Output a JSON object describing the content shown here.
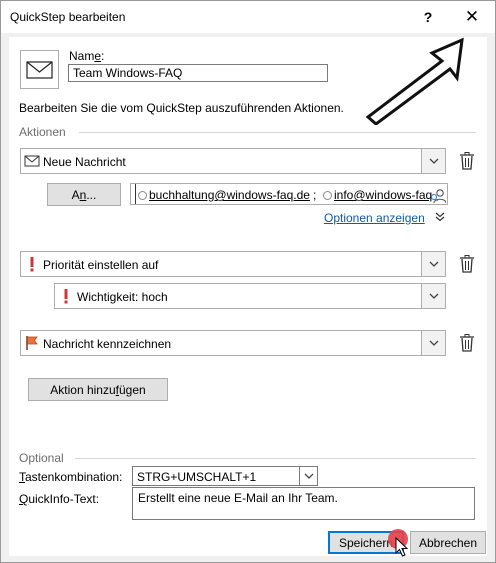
{
  "window": {
    "title": "QuickStep bearbeiten",
    "help_glyph": "?",
    "close_glyph": "✕"
  },
  "name": {
    "label_prefix": "Nam",
    "label_mnemonic": "e",
    "label_suffix": ":",
    "value": "Team Windows-FAQ"
  },
  "instruction": "Bearbeiten Sie die vom QuickStep auszuführenden Aktionen.",
  "actions": {
    "group_label": "Aktionen",
    "items": [
      {
        "label": "Neue Nachricht",
        "icon": "envelope-icon"
      },
      {
        "label": "Priorität einstellen auf",
        "icon": "exclamation-icon",
        "sub_option": "Wichtigkeit: hoch"
      },
      {
        "label": "Nachricht kennzeichnen",
        "icon": "flag-icon"
      }
    ],
    "to_button": {
      "prefix": "A",
      "mnemonic": "n",
      "suffix": "..."
    },
    "recipients": [
      "buchhaltung@windows-faq.de",
      "info@windows-faq"
    ],
    "recipient_separator": ";",
    "show_options_link": "Optionen anzeigen",
    "add_action_button": {
      "prefix": "Aktion hinzu",
      "mnemonic": "f",
      "suffix": "ügen"
    }
  },
  "optional": {
    "group_label": "Optional",
    "shortcut_label_mnemonic": "T",
    "shortcut_label_rest": "astenkombination:",
    "shortcut_value": "STRG+UMSCHALT+1",
    "tooltip_label_mnemonic": "Q",
    "tooltip_label_rest": "uickInfo-Text:",
    "tooltip_value": "Erstellt eine neue E-Mail an Ihr Team."
  },
  "footer": {
    "save_label": "Speichern",
    "cancel_label": "Abbrechen"
  },
  "colors": {
    "accent": "#0078d7",
    "priority_red": "#d13438",
    "flag_orange": "#e8743b",
    "cursor_dot": "#e8404a"
  }
}
